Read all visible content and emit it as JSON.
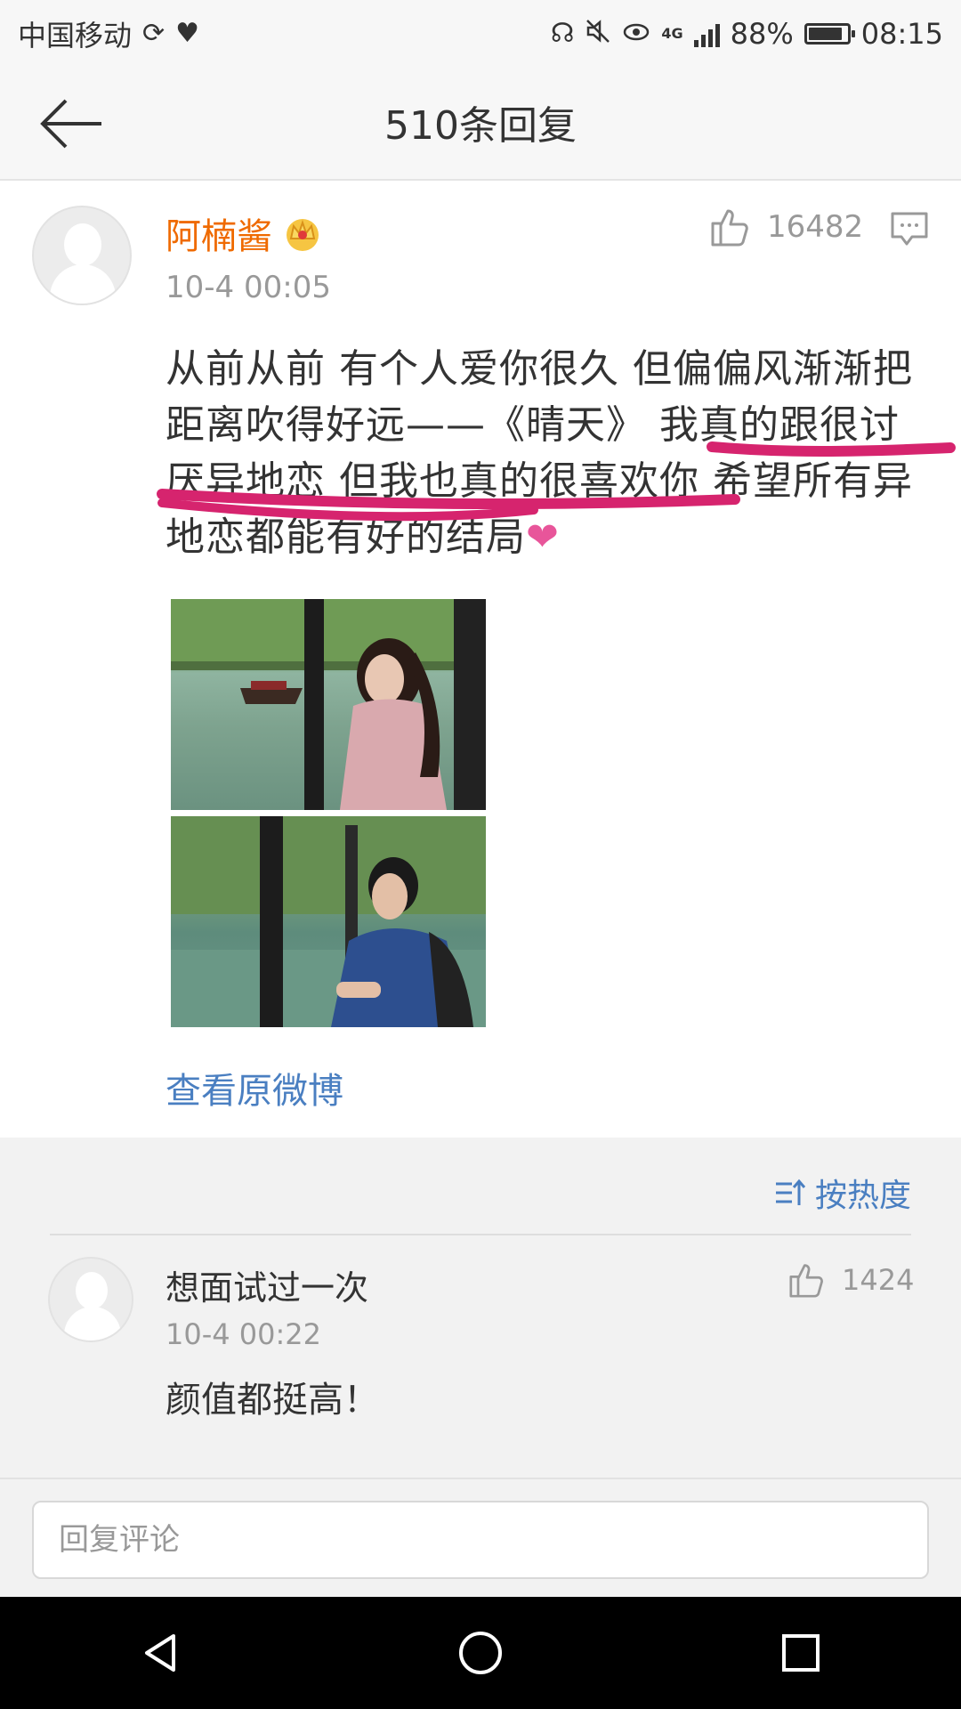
{
  "status_bar": {
    "carrier": "中国移动",
    "network": "4G",
    "battery": "88%",
    "battery_level": 0.88,
    "time": "08:15"
  },
  "header": {
    "title": "510条回复",
    "back_icon": "back-arrow-icon"
  },
  "main_comment": {
    "username": "阿楠酱",
    "badge_icon": "crown-vip-icon",
    "time": "10-4 00:05",
    "likes": "16482",
    "text": "从前从前 有个人爱你很久 但偏偏风渐渐把距离吹得好远——《晴天》 我真的跟很讨厌异地恋 但我也真的很喜欢你 希望所有异地恋都能有好的结局",
    "heart": "❤",
    "annotation_color": "#d6246e",
    "photos": [
      {
        "icon": "photo-girl-by-river"
      },
      {
        "icon": "photo-boy-by-river"
      }
    ],
    "view_original": "查看原微博"
  },
  "replies": {
    "sort_label": "按热度",
    "items": [
      {
        "username": "想面试过一次",
        "time": "10-4 00:22",
        "likes": "1424",
        "text": "颜值都挺高！"
      }
    ]
  },
  "reply_bar": {
    "placeholder": "回复评论"
  },
  "colors": {
    "username_accent": "#ef6a00",
    "link": "#4a7fc1",
    "meta": "#999999"
  }
}
